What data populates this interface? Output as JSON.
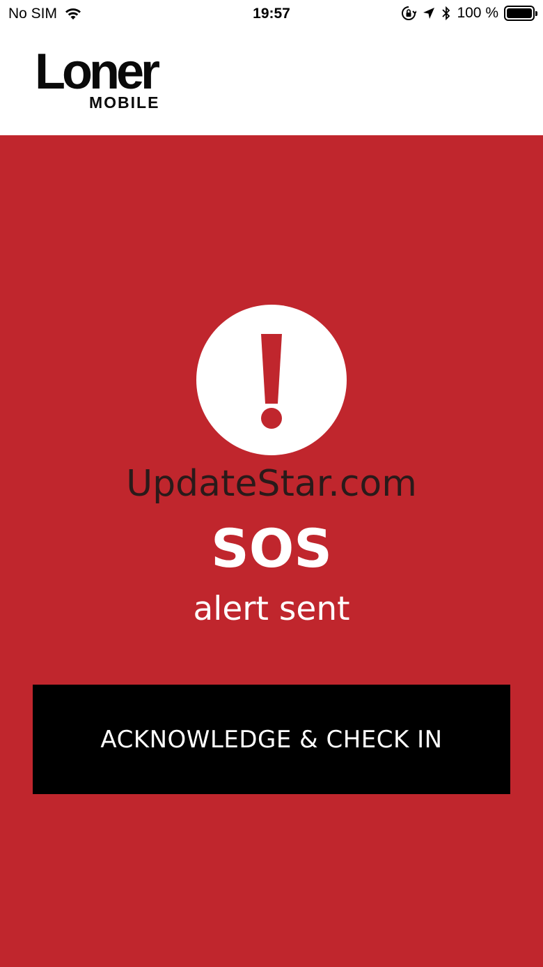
{
  "status_bar": {
    "carrier": "No SIM",
    "time": "19:57",
    "battery_percent": "100 %",
    "battery_level": 1.0,
    "icons": [
      "wifi-icon",
      "orientation-lock-icon",
      "location-arrow-icon",
      "bluetooth-icon",
      "battery-icon"
    ]
  },
  "header": {
    "logo_main": "Loner",
    "logo_sub": "MOBILE"
  },
  "alert": {
    "icon": "exclamation-circle-icon",
    "watermark": "UpdateStar.com",
    "title": "SOS",
    "subtitle": "alert sent",
    "button_label": "ACKNOWLEDGE & CHECK IN"
  },
  "colors": {
    "alert_background": "#c0262d",
    "button_background": "#000000",
    "text_light": "#ffffff",
    "header_background": "#ffffff"
  }
}
